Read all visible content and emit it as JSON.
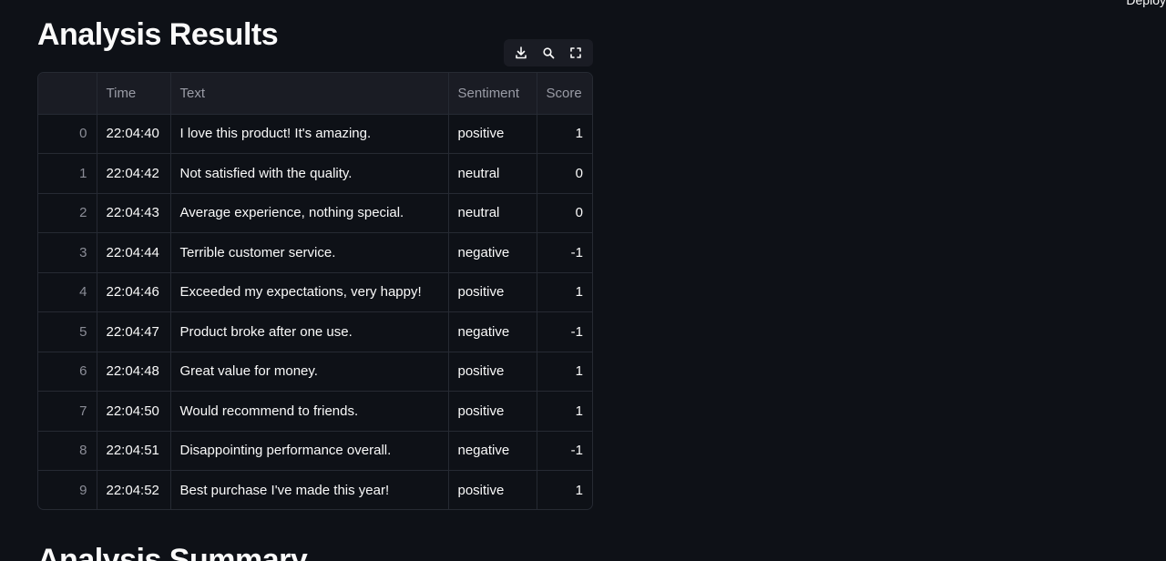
{
  "header": {
    "deploy_label": "Deploy"
  },
  "page_title": "Analysis Results",
  "summary_title": "Analysis Summary",
  "table": {
    "columns": [
      "",
      "Time",
      "Text",
      "Sentiment",
      "Score"
    ],
    "rows": [
      {
        "index": "0",
        "time": "22:04:40",
        "text": "I love this product! It's amazing.",
        "sentiment": "positive",
        "score": "1"
      },
      {
        "index": "1",
        "time": "22:04:42",
        "text": "Not satisfied with the quality.",
        "sentiment": "neutral",
        "score": "0"
      },
      {
        "index": "2",
        "time": "22:04:43",
        "text": "Average experience, nothing special.",
        "sentiment": "neutral",
        "score": "0"
      },
      {
        "index": "3",
        "time": "22:04:44",
        "text": "Terrible customer service.",
        "sentiment": "negative",
        "score": "-1"
      },
      {
        "index": "4",
        "time": "22:04:46",
        "text": "Exceeded my expectations, very happy!",
        "sentiment": "positive",
        "score": "1"
      },
      {
        "index": "5",
        "time": "22:04:47",
        "text": "Product broke after one use.",
        "sentiment": "negative",
        "score": "-1"
      },
      {
        "index": "6",
        "time": "22:04:48",
        "text": "Great value for money.",
        "sentiment": "positive",
        "score": "1"
      },
      {
        "index": "7",
        "time": "22:04:50",
        "text": "Would recommend to friends.",
        "sentiment": "positive",
        "score": "1"
      },
      {
        "index": "8",
        "time": "22:04:51",
        "text": "Disappointing performance overall.",
        "sentiment": "negative",
        "score": "-1"
      },
      {
        "index": "9",
        "time": "22:04:52",
        "text": "Best purchase I've made this year!",
        "sentiment": "positive",
        "score": "1"
      }
    ]
  },
  "toolbar": {
    "icons": [
      "download-icon",
      "search-icon",
      "fullscreen-icon"
    ]
  },
  "colors": {
    "background": "#0e1117",
    "header_bg": "#1a1c24",
    "border": "#262a33",
    "text": "#fafafa",
    "muted": "#8b8d97"
  }
}
